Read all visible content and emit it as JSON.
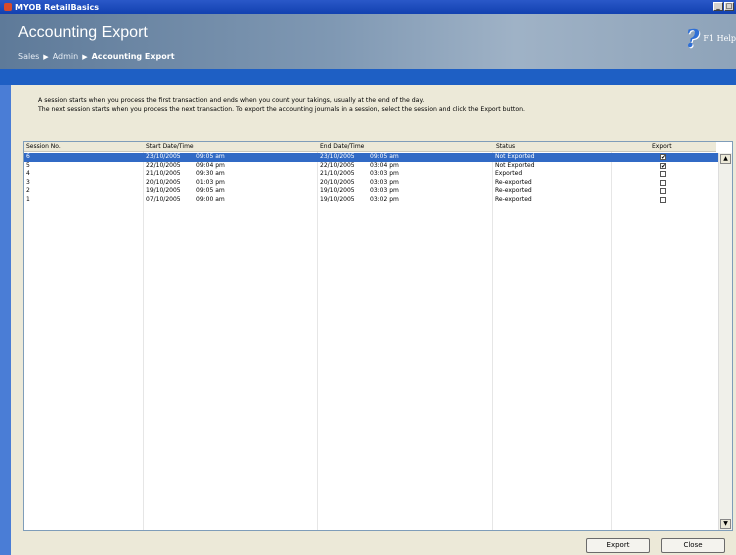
{
  "window": {
    "title": "MYOB RetailBasics"
  },
  "header": {
    "title": "Accounting Export",
    "breadcrumbs": [
      "Sales",
      "Admin",
      "Accounting Export"
    ],
    "help_label": "F1 Help"
  },
  "info": {
    "line1": "A session starts when you process the first transaction and ends when you count your takings, usually at the end of the day.",
    "line2": "The next session starts when you process the next transaction.  To export the accounting journals in a session, select the session and click the Export button."
  },
  "table": {
    "columns": [
      "Session No.",
      "Start Date/Time",
      "End Date/Time",
      "Status",
      "Export"
    ],
    "rows": [
      {
        "session": "6",
        "start_date": "23/10/2005",
        "start_time": "09:05 am",
        "end_date": "23/10/2005",
        "end_time": "09:05 am",
        "status": "Not Exported",
        "export": "✔"
      },
      {
        "session": "5",
        "start_date": "22/10/2005",
        "start_time": "09:04 pm",
        "end_date": "22/10/2005",
        "end_time": "03:04 pm",
        "status": "Not Exported",
        "export": "✔"
      },
      {
        "session": "4",
        "start_date": "21/10/2005",
        "start_time": "09:30 am",
        "end_date": "21/10/2005",
        "end_time": "03:03 pm",
        "status": "Exported",
        "export": ""
      },
      {
        "session": "3",
        "start_date": "20/10/2005",
        "start_time": "01:03 pm",
        "end_date": "20/10/2005",
        "end_time": "03:03 pm",
        "status": "Re-exported",
        "export": ""
      },
      {
        "session": "2",
        "start_date": "19/10/2005",
        "start_time": "09:05 am",
        "end_date": "19/10/2005",
        "end_time": "03:03 pm",
        "status": "Re-exported",
        "export": ""
      },
      {
        "session": "1",
        "start_date": "07/10/2005",
        "start_time": "09:00 am",
        "end_date": "19/10/2005",
        "end_time": "03:02 pm",
        "status": "Re-exported",
        "export": ""
      }
    ]
  },
  "buttons": {
    "export": "Export",
    "close": "Close"
  },
  "colors": {
    "selection": "#316ac5",
    "band": "#1e5fc4",
    "header_gradient": "#7f98b3"
  }
}
